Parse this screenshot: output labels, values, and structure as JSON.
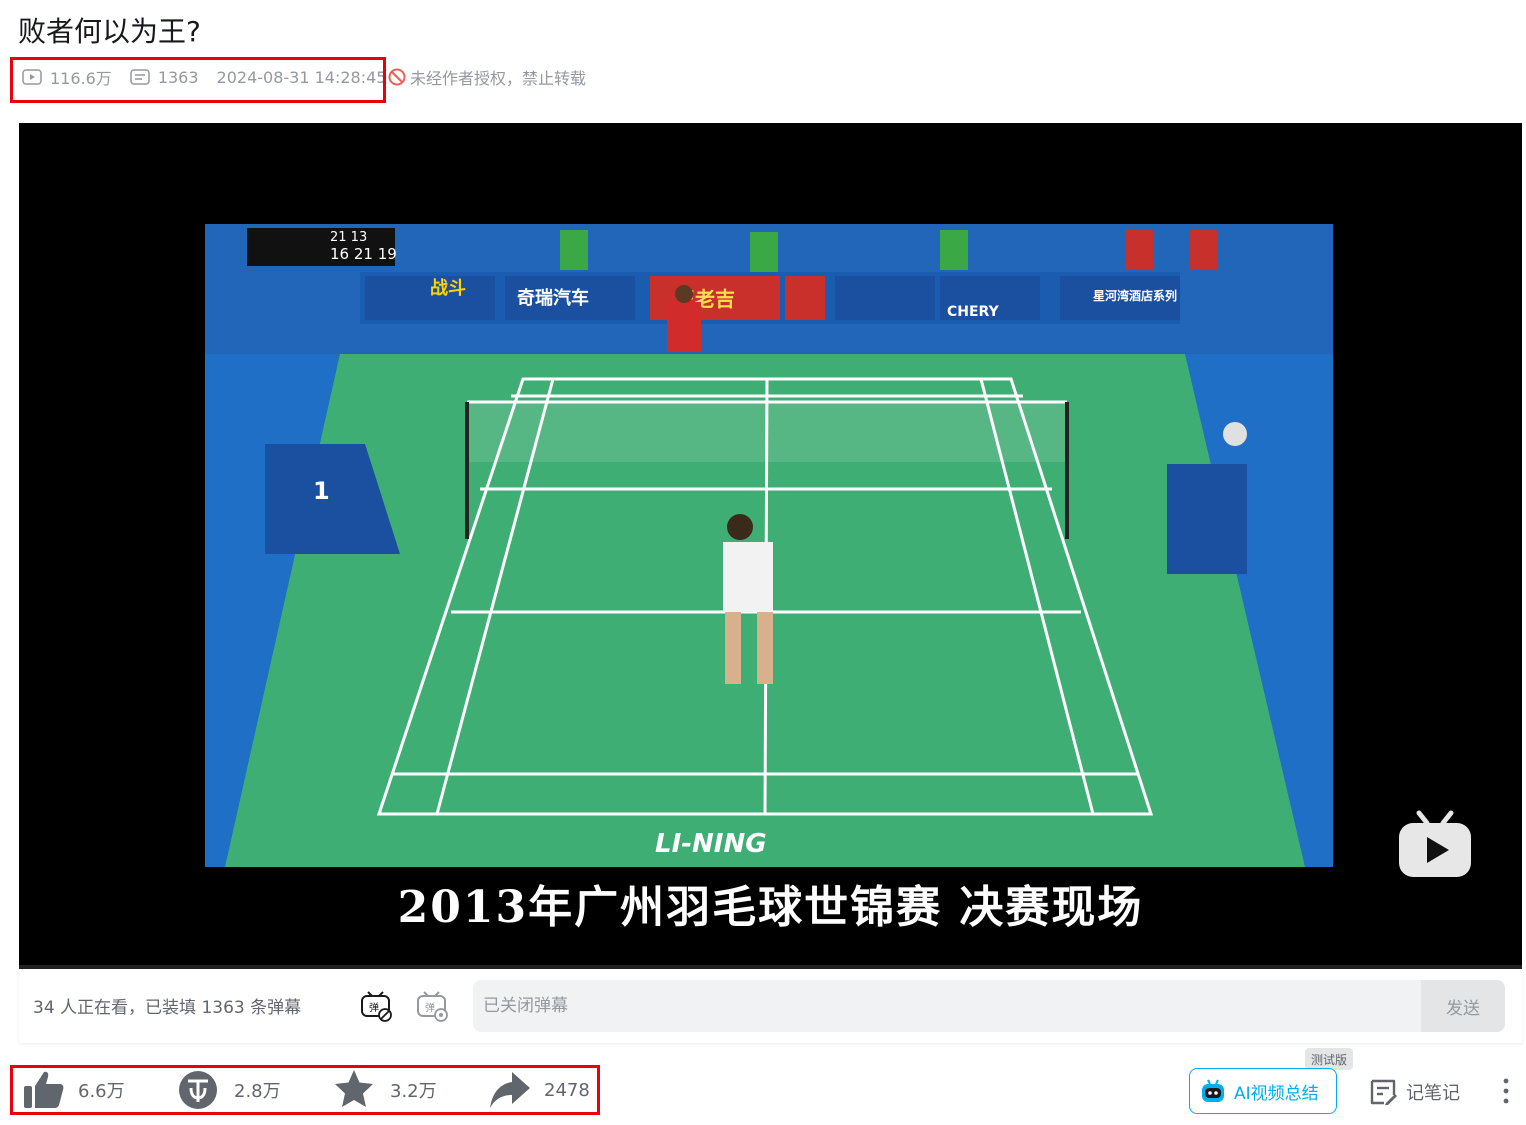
{
  "video": {
    "title": "败者何以为王?",
    "views": "116.6万",
    "danmaku_count": "1363",
    "publish_time": "2024-08-31 14:28:45",
    "copyright_notice": "未经作者授权，禁止转载"
  },
  "player": {
    "subtitle": "2013年广州羽毛球世锦赛 决赛现场",
    "scene_text": {
      "scoreboard_row1": "21 13",
      "scoreboard_row2": "16 21 19",
      "court_number": "1",
      "brand": "LI-NING",
      "sponsor_1": "奇瑞汽车",
      "sponsor_2": "王老吉",
      "sponsor_3": "CHERY",
      "sponsor_4": "星河湾酒店系列",
      "sponsor_5": "战斗"
    }
  },
  "danmaku_bar": {
    "status_text": "34 人正在看，已装填 1363 条弹幕",
    "input_placeholder": "已关闭弹幕",
    "send_label": "发送"
  },
  "toolbar": {
    "like_count": "6.6万",
    "coin_count": "2.8万",
    "favorite_count": "3.2万",
    "share_count": "2478",
    "ai_summary_label": "AI视频总结",
    "beta_tag": "测试版",
    "note_label": "记笔记"
  },
  "colors": {
    "accent": "#00aeec",
    "highlight_box": "#e8000b",
    "muted_text": "#9499a0",
    "court_green": "#3fae74",
    "court_blue": "#1d74c8"
  }
}
